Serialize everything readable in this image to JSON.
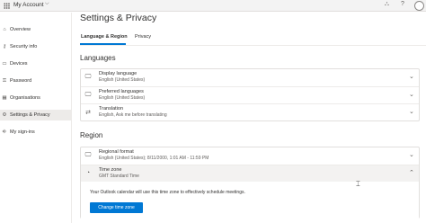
{
  "header": {
    "app_title": "My Account",
    "chevron": "⌵",
    "icons": [
      "org-chart-icon",
      "help-icon"
    ],
    "avatar_initials": "·"
  },
  "sidebar": {
    "items": [
      {
        "label": "Overview",
        "icon": "⌂",
        "icon_name": "home-icon",
        "active": false
      },
      {
        "label": "Security info",
        "icon": "⚷",
        "icon_name": "key-icon",
        "active": false
      },
      {
        "label": "Devices",
        "icon": "▭",
        "icon_name": "laptop-icon",
        "active": false
      },
      {
        "label": "Password",
        "icon": "⚿",
        "icon_name": "password-icon",
        "active": false
      },
      {
        "label": "Organisations",
        "icon": "▦",
        "icon_name": "building-icon",
        "active": false
      },
      {
        "label": "Settings & Privacy",
        "icon": "⚙",
        "icon_name": "gear-icon",
        "active": true
      },
      {
        "label": "My sign-ins",
        "icon": "⎆",
        "icon_name": "sign-in-icon",
        "active": false
      }
    ]
  },
  "main": {
    "title": "Settings & Privacy",
    "tabs": [
      {
        "label": "Language & Region",
        "active": true
      },
      {
        "label": "Privacy",
        "active": false
      }
    ],
    "languages": {
      "title": "Languages",
      "rows": [
        {
          "title": "Display language",
          "value": "English (United States)",
          "icon": "🖵"
        },
        {
          "title": "Preferred languages",
          "value": "English (United States)",
          "icon": "🖵"
        },
        {
          "title": "Translation",
          "value": "English, Ask me before translating",
          "icon": "⇄"
        }
      ]
    },
    "region": {
      "title": "Region",
      "format": {
        "title": "Regional format",
        "value": "English (United States); 8/11/2000, 1:01 AM - 11:59 PM",
        "icon": "🖵"
      },
      "timezone": {
        "title": "Time zone",
        "value": "GMT Standard Time",
        "icon": "◔",
        "description": "Your Outlook calendar will use this time zone to effectively schedule meetings.",
        "button_label": "Change time zone"
      }
    },
    "chevron_down": "⌄",
    "chevron_up": "⌃"
  },
  "colors": {
    "accent": "#0078d4",
    "active_nav": "#edebe9"
  }
}
